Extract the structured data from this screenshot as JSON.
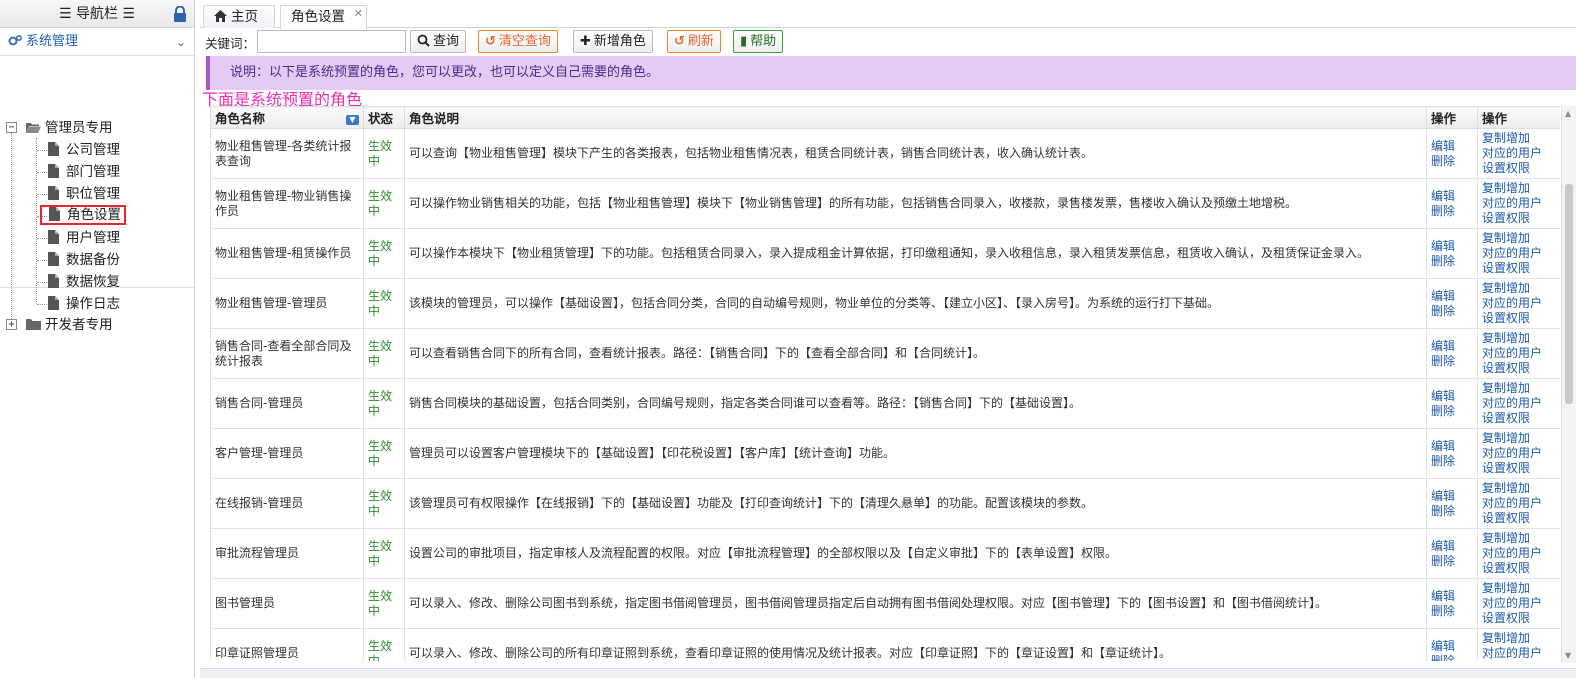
{
  "sidebar": {
    "header": "☰ 导航栏 ☰",
    "group": "系统管理",
    "tree": {
      "root1": "管理员专用",
      "items": [
        "公司管理",
        "部门管理",
        "职位管理",
        "角色设置",
        "用户管理",
        "数据备份",
        "数据恢复",
        "操作日志"
      ],
      "root2": "开发者专用"
    }
  },
  "tabs": {
    "home": "主页",
    "active": "角色设置"
  },
  "toolbar": {
    "keyword_label": "关键词：",
    "keyword_value": "",
    "query": "查询",
    "clear": "清空查询",
    "add": "新增角色",
    "refresh": "刷新",
    "help": "帮助"
  },
  "notice": "说明：以下是系统预置的角色，您可以更改，也可以定义自己需要的角色。",
  "subtitle": "下面是系统预置的角色",
  "grid": {
    "columns": [
      "角色名称",
      "状态",
      "角色说明",
      "操作",
      "操作"
    ],
    "edit_label": "编辑",
    "delete_label": "删除",
    "copy_label": "复制增加",
    "user_label": "对应的用户",
    "perm_label": "设置权限",
    "rows": [
      {
        "name": "物业租售管理-各类统计报表查询",
        "status": "生效中",
        "desc": "可以查询【物业租售管理】模块下产生的各类报表，包括物业租售情况表，租赁合同统计表，销售合同统计表，收入确认统计表。"
      },
      {
        "name": "物业租售管理-物业销售操作员",
        "status": "生效中",
        "desc": "可以操作物业销售相关的功能，包括【物业租售管理】模块下【物业销售管理】的所有功能，包括销售合同录入，收楼款，录售楼发票，售楼收入确认及预缴土地增税。"
      },
      {
        "name": "物业租售管理-租赁操作员",
        "status": "生效中",
        "desc": "可以操作本模块下【物业租赁管理】下的功能。包括租赁合同录入，录入提成租金计算依据，打印缴租通知，录入收租信息，录入租赁发票信息，租赁收入确认，及租赁保证金录入。"
      },
      {
        "name": "物业租售管理-管理员",
        "status": "生效中",
        "desc": "该模块的管理员，可以操作【基础设置】，包括合同分类，合同的自动编号规则，物业单位的分类等、【建立小区】、【录入房号】。为系统的运行打下基础。"
      },
      {
        "name": "销售合同-查看全部合同及统计报表",
        "status": "生效中",
        "desc": "可以查看销售合同下的所有合同，查看统计报表。路径：【销售合同】下的【查看全部合同】和【合同统计】。"
      },
      {
        "name": "销售合同-管理员",
        "status": "生效中",
        "desc": "销售合同模块的基础设置，包括合同类别，合同编号规则，指定各类合同谁可以查看等。路径：【销售合同】下的【基础设置】。"
      },
      {
        "name": "客户管理-管理员",
        "status": "生效中",
        "desc": "管理员可以设置客户管理模块下的【基础设置】【印花税设置】【客户库】【统计查询】功能。"
      },
      {
        "name": "在线报销-管理员",
        "status": "生效中",
        "desc": "该管理员可有权限操作【在线报销】下的【基础设置】功能及【打印查询统计】下的【清理久悬单】的功能。配置该模块的参数。"
      },
      {
        "name": "审批流程管理员",
        "status": "生效中",
        "desc": "设置公司的审批项目，指定审核人及流程配置的权限。对应【审批流程管理】的全部权限以及【自定义审批】下的【表单设置】权限。"
      },
      {
        "name": "图书管理员",
        "status": "生效中",
        "desc": "可以录入、修改、删除公司图书到系统，指定图书借阅管理员，图书借阅管理员指定后自动拥有图书借阅处理权限。对应【图书管理】下的【图书设置】和【图书借阅统计】。"
      },
      {
        "name": "印章证照管理员",
        "status": "生效中",
        "desc": "可以录入、修改、删除公司的所有印章证照到系统，查看印章证照的使用情况及统计报表。对应【印章证照】下的【章证设置】和【章证统计】。"
      }
    ]
  },
  "colors": {
    "accent": "#1a64b0",
    "notice_bg": "#e5cbf3",
    "subtitle": "#e830b4",
    "status": "#2f8a2f",
    "selected_border": "#e8262b"
  }
}
